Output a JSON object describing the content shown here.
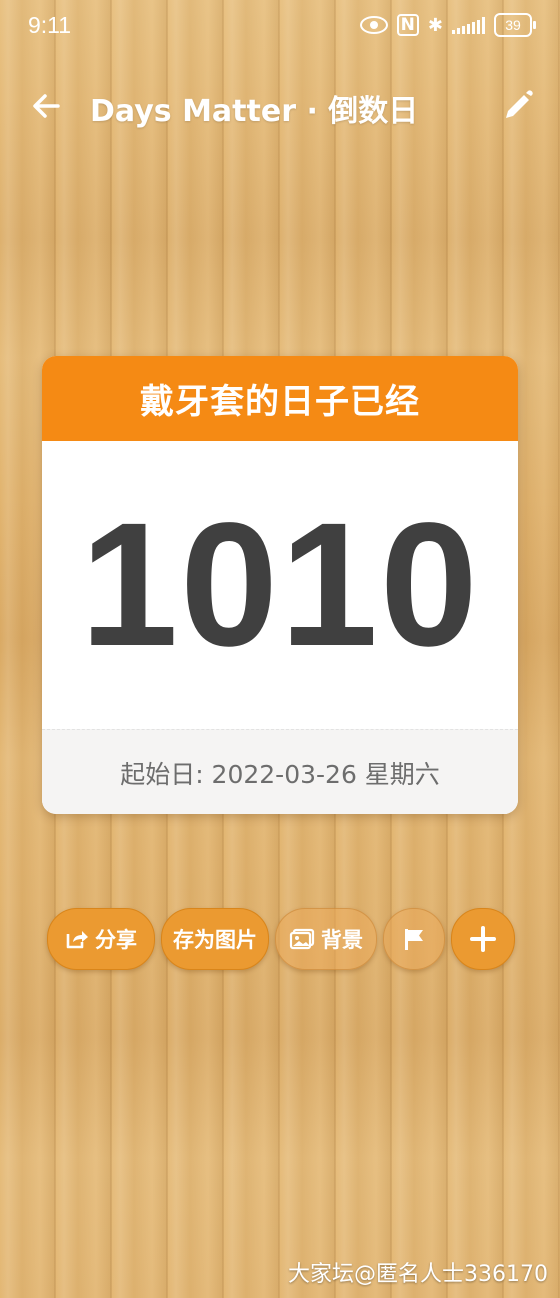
{
  "status_bar": {
    "time": "9:11",
    "battery": "39",
    "nfc_label": "N",
    "bluetooth_glyph": "✱"
  },
  "app_bar": {
    "title": "Days Matter · 倒数日",
    "back_icon": "back-arrow-icon",
    "edit_icon": "pencil-icon"
  },
  "card": {
    "title": "戴牙套的日子已经",
    "days": "1010",
    "start_date": "起始日: 2022-03-26 星期六",
    "header_color": "#f58a14"
  },
  "actions": {
    "share_label": "分享",
    "save_image_label": "存为图片",
    "background_label": "背景",
    "flag_icon": "flag-icon",
    "add_icon": "plus-icon"
  },
  "watermark": "大家坛@匿名人士336170"
}
